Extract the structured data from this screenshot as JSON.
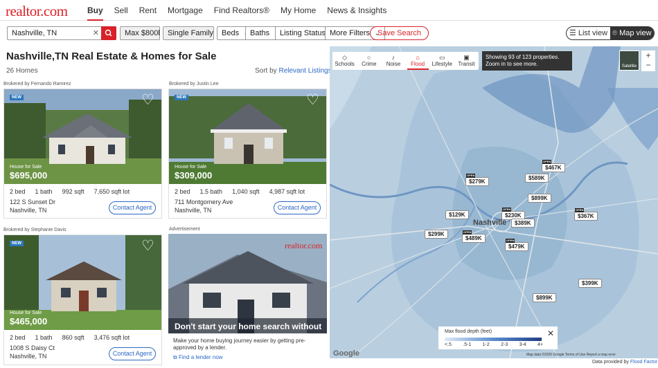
{
  "nav": {
    "logo": "realtor.com",
    "links": [
      "Buy",
      "Sell",
      "Rent",
      "Mortgage",
      "Find Realtors®",
      "My Home",
      "News & Insights"
    ]
  },
  "filters": {
    "search_value": "Nashville, TN",
    "max_price": "Max $800k",
    "home_type": "Single Family ...",
    "beds": "Beds",
    "baths": "Baths",
    "listing_status": "Listing Status",
    "more_filters": "More Filters",
    "save_search": "Save Search",
    "list_view": "List view",
    "map_view": "Map view"
  },
  "page": {
    "title": "Nashville,TN  Real Estate & Homes for Sale",
    "count": "26 Homes",
    "sort_label": "Sort by",
    "sort_value": "Relevant Listings"
  },
  "listings": [
    {
      "broker": "Brokered by Fernando Ramirez",
      "badge": "NEW",
      "type": "House for Sale",
      "price": "$695,000",
      "beds": "2 bed",
      "baths": "1 bath",
      "sqft": "992 sqft",
      "lot": "7,650 sqft lot",
      "street": "122 S Sunset Dr",
      "city": "Nashville, TN",
      "cta": "Contact Agent"
    },
    {
      "broker": "Brokered by Justin Lee",
      "badge": "NEW",
      "type": "House for Sale",
      "price": "$309,000",
      "beds": "2 bed",
      "baths": "1.5 bath",
      "sqft": "1,040 sqft",
      "lot": "4,987 sqft lot",
      "street": "711 Montgomery Ave",
      "city": "Nashville, TN",
      "cta": "Contact Agent"
    },
    {
      "broker": "Brokered by Stephanie Davis",
      "badge": "NEW",
      "type": "House for Sale",
      "price": "$465,000",
      "beds": "2 bed",
      "baths": "1 bath",
      "sqft": "860 sqft",
      "lot": "3,476 sqft lot",
      "street": "1008 S Daisy Ct",
      "city": "Nashville, TN",
      "cta": "Contact Agent"
    }
  ],
  "ad": {
    "label": "Advertisement",
    "brand": "realtor.com",
    "headline": "Don't start your home search without it.",
    "body": "Make your home buying journey easier by getting pre-approved by a lender.",
    "link": "Find a lender now"
  },
  "map": {
    "tools": [
      "Schools",
      "Crime",
      "Noise",
      "Flood",
      "Lifestyle",
      "Transit"
    ],
    "active_tool": "Flood",
    "showing": "Showing 93 of 123 properties. Zoom in to see more.",
    "satellite": "Satellite",
    "city_label": "Nashville",
    "pins": [
      {
        "label": "$467K",
        "open": true
      },
      {
        "label": "$279K",
        "open": true
      },
      {
        "label": "$589K",
        "open": false
      },
      {
        "label": "$899K",
        "open": false
      },
      {
        "label": "$129K",
        "open": false
      },
      {
        "label": "$230K",
        "open": true
      },
      {
        "label": "$389K",
        "open": false
      },
      {
        "label": "$367K",
        "open": true
      },
      {
        "label": "$299K",
        "open": false
      },
      {
        "label": "$489K",
        "open": true
      },
      {
        "label": "$479K",
        "open": true
      },
      {
        "label": "$399K",
        "open": false
      },
      {
        "label": "$899K",
        "open": false
      }
    ],
    "legend": {
      "title": "Max flood depth (feet)",
      "ticks": [
        "<.5",
        ".5-1",
        "1-2",
        "2-3",
        "3-4",
        "4+"
      ]
    },
    "attribution": "Map data ©2020 Google   Terms of Use   Report a map error",
    "data_provider_label": "Data provided by",
    "data_provider": "Flood Factor",
    "google": "Google"
  },
  "colors": {
    "brand": "#d92228",
    "link": "#2c66c5"
  }
}
